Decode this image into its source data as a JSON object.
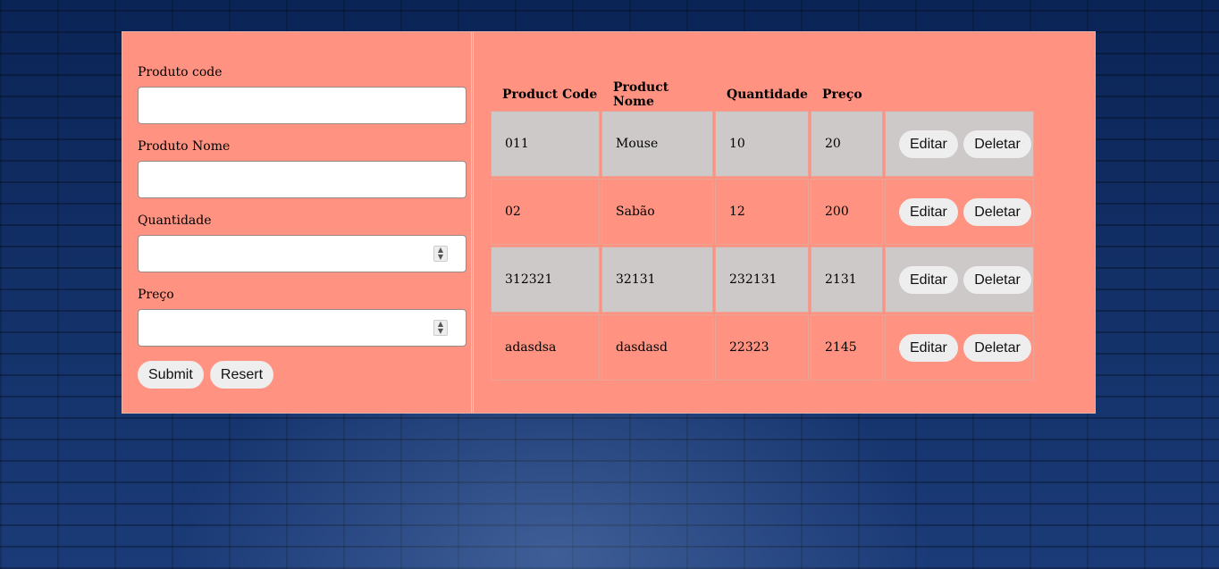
{
  "form": {
    "fields": [
      {
        "label": "Produto code",
        "value": "",
        "type": "text"
      },
      {
        "label": "Produto Nome",
        "value": "",
        "type": "text"
      },
      {
        "label": "Quantidade",
        "value": "",
        "type": "number"
      },
      {
        "label": "Preço",
        "value": "",
        "type": "number"
      }
    ],
    "submit_label": "Submit",
    "reset_label": "Resert"
  },
  "table": {
    "headers": [
      "Product Code",
      "Product Nome",
      "Quantidade",
      "Preço"
    ],
    "rows": [
      {
        "code": "011",
        "name": "Mouse",
        "qty": "10",
        "price": "20"
      },
      {
        "code": "02",
        "name": "Sabão",
        "qty": "12",
        "price": "200"
      },
      {
        "code": "312321",
        "name": "32131",
        "qty": "232131",
        "price": "2131"
      },
      {
        "code": "adasdsa",
        "name": "dasdasd",
        "qty": "22323",
        "price": "2145"
      }
    ],
    "edit_label": "Editar",
    "delete_label": "Deletar"
  },
  "colors": {
    "panel": "#ff9280",
    "row_alt": "#cdc9c9",
    "page_bg": "#0f2a5e"
  }
}
